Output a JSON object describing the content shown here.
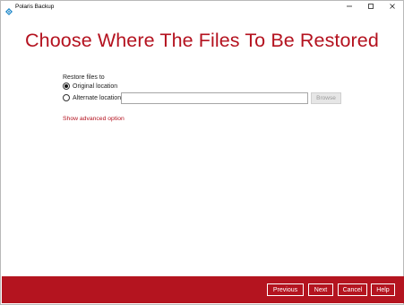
{
  "window": {
    "title": "Polaris Backup",
    "controls": {
      "minimize": "—",
      "maximize": "☐",
      "close": "✕"
    }
  },
  "page": {
    "title": "Choose Where The Files To Be Restored"
  },
  "restore": {
    "label": "Restore files to",
    "options": [
      {
        "label": "Original location",
        "selected": true
      },
      {
        "label": "Alternate location",
        "selected": false
      }
    ],
    "alternate_path_value": "",
    "browse_label": "Browse"
  },
  "advanced": {
    "link_label": "Show advanced option"
  },
  "footer": {
    "previous_label": "Previous",
    "next_label": "Next",
    "cancel_label": "Cancel",
    "help_label": "Help"
  },
  "colors": {
    "accent": "#b4121f",
    "footer_bg": "#b4141f",
    "app_icon": "#1e88c9"
  },
  "icons": {
    "app": "polaris-app-icon"
  }
}
